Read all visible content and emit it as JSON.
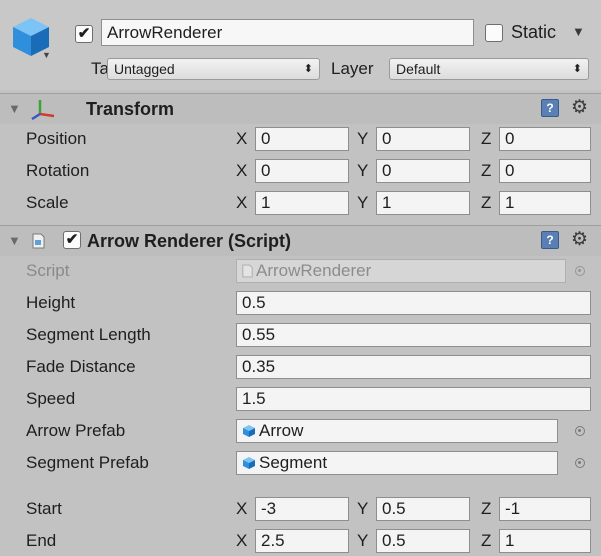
{
  "header": {
    "object_name": "ArrowRenderer",
    "active": true,
    "static_label": "Static",
    "static_checked": false,
    "tag_label": "Tag",
    "tag_value": "Untagged",
    "layer_label": "Layer",
    "layer_value": "Default"
  },
  "transform": {
    "title": "Transform",
    "rows": [
      {
        "label": "Position",
        "x": "0",
        "y": "0",
        "z": "0"
      },
      {
        "label": "Rotation",
        "x": "0",
        "y": "0",
        "z": "0"
      },
      {
        "label": "Scale",
        "x": "1",
        "y": "1",
        "z": "1"
      }
    ]
  },
  "script_component": {
    "title": "Arrow Renderer (Script)",
    "enabled": true,
    "script_label": "Script",
    "script_value": "ArrowRenderer",
    "fields": [
      {
        "label": "Height",
        "value": "0.5"
      },
      {
        "label": "Segment Length",
        "value": "0.55"
      },
      {
        "label": "Fade Distance",
        "value": "0.35"
      },
      {
        "label": "Speed",
        "value": "1.5"
      }
    ],
    "arrow_prefab_label": "Arrow Prefab",
    "arrow_prefab_value": "Arrow",
    "segment_prefab_label": "Segment Prefab",
    "segment_prefab_value": "Segment",
    "start": {
      "label": "Start",
      "x": "-3",
      "y": "0.5",
      "z": "-1"
    },
    "end": {
      "label": "End",
      "x": "2.5",
      "y": "0.5",
      "z": "1"
    }
  },
  "axes": {
    "x": "X",
    "y": "Y",
    "z": "Z"
  },
  "icons": {
    "object": "cube-icon",
    "transform": "transform-axes-icon",
    "script": "script-file-icon",
    "help": "help-book-icon",
    "settings": "gear-icon",
    "picker": "object-picker-icon"
  },
  "colors": {
    "panel": "#c2c2c2",
    "field": "#f4f4f4",
    "cube": "#2f8fdc",
    "help_icon": "#5a7fb4"
  }
}
